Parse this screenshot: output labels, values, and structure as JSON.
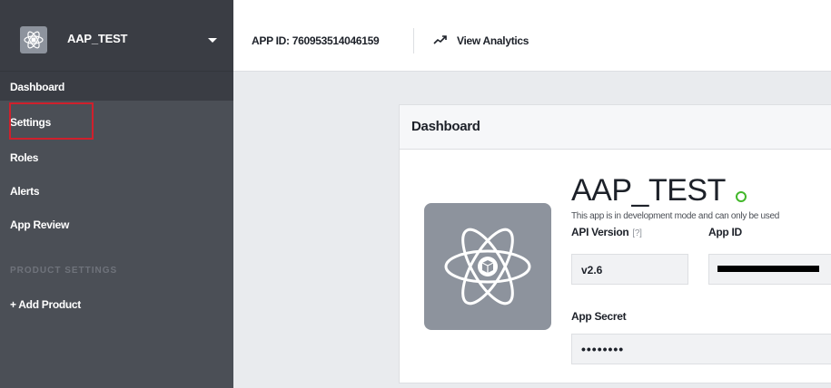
{
  "app_switcher": {
    "name": "AAP_TEST",
    "icon": "atom-icon"
  },
  "sidebar": {
    "items": [
      {
        "label": "Dashboard",
        "active": true
      },
      {
        "label": "Settings"
      },
      {
        "label": "Roles"
      },
      {
        "label": "Alerts"
      },
      {
        "label": "App Review"
      }
    ],
    "section_label": "PRODUCT SETTINGS",
    "add_product": "+ Add Product"
  },
  "topbar": {
    "app_id": "APP ID: 760953514046159",
    "analytics_label": "View Analytics",
    "analytics_icon": "trend-up-icon"
  },
  "card": {
    "title": "Dashboard",
    "app_name": "AAP_TEST",
    "dev_note": "This app is in development mode and can only be used",
    "api_version_label": "API Version",
    "api_version_hint": "[?]",
    "api_version_value": "v2.6",
    "app_id_label": "App ID",
    "app_secret_label": "App Secret",
    "app_secret_value": "••••••••"
  },
  "colors": {
    "sidebar_bg": "#4b4f56",
    "sidebar_active": "#3a3d44",
    "highlight": "#d0202c",
    "status_green": "#42b72a"
  }
}
